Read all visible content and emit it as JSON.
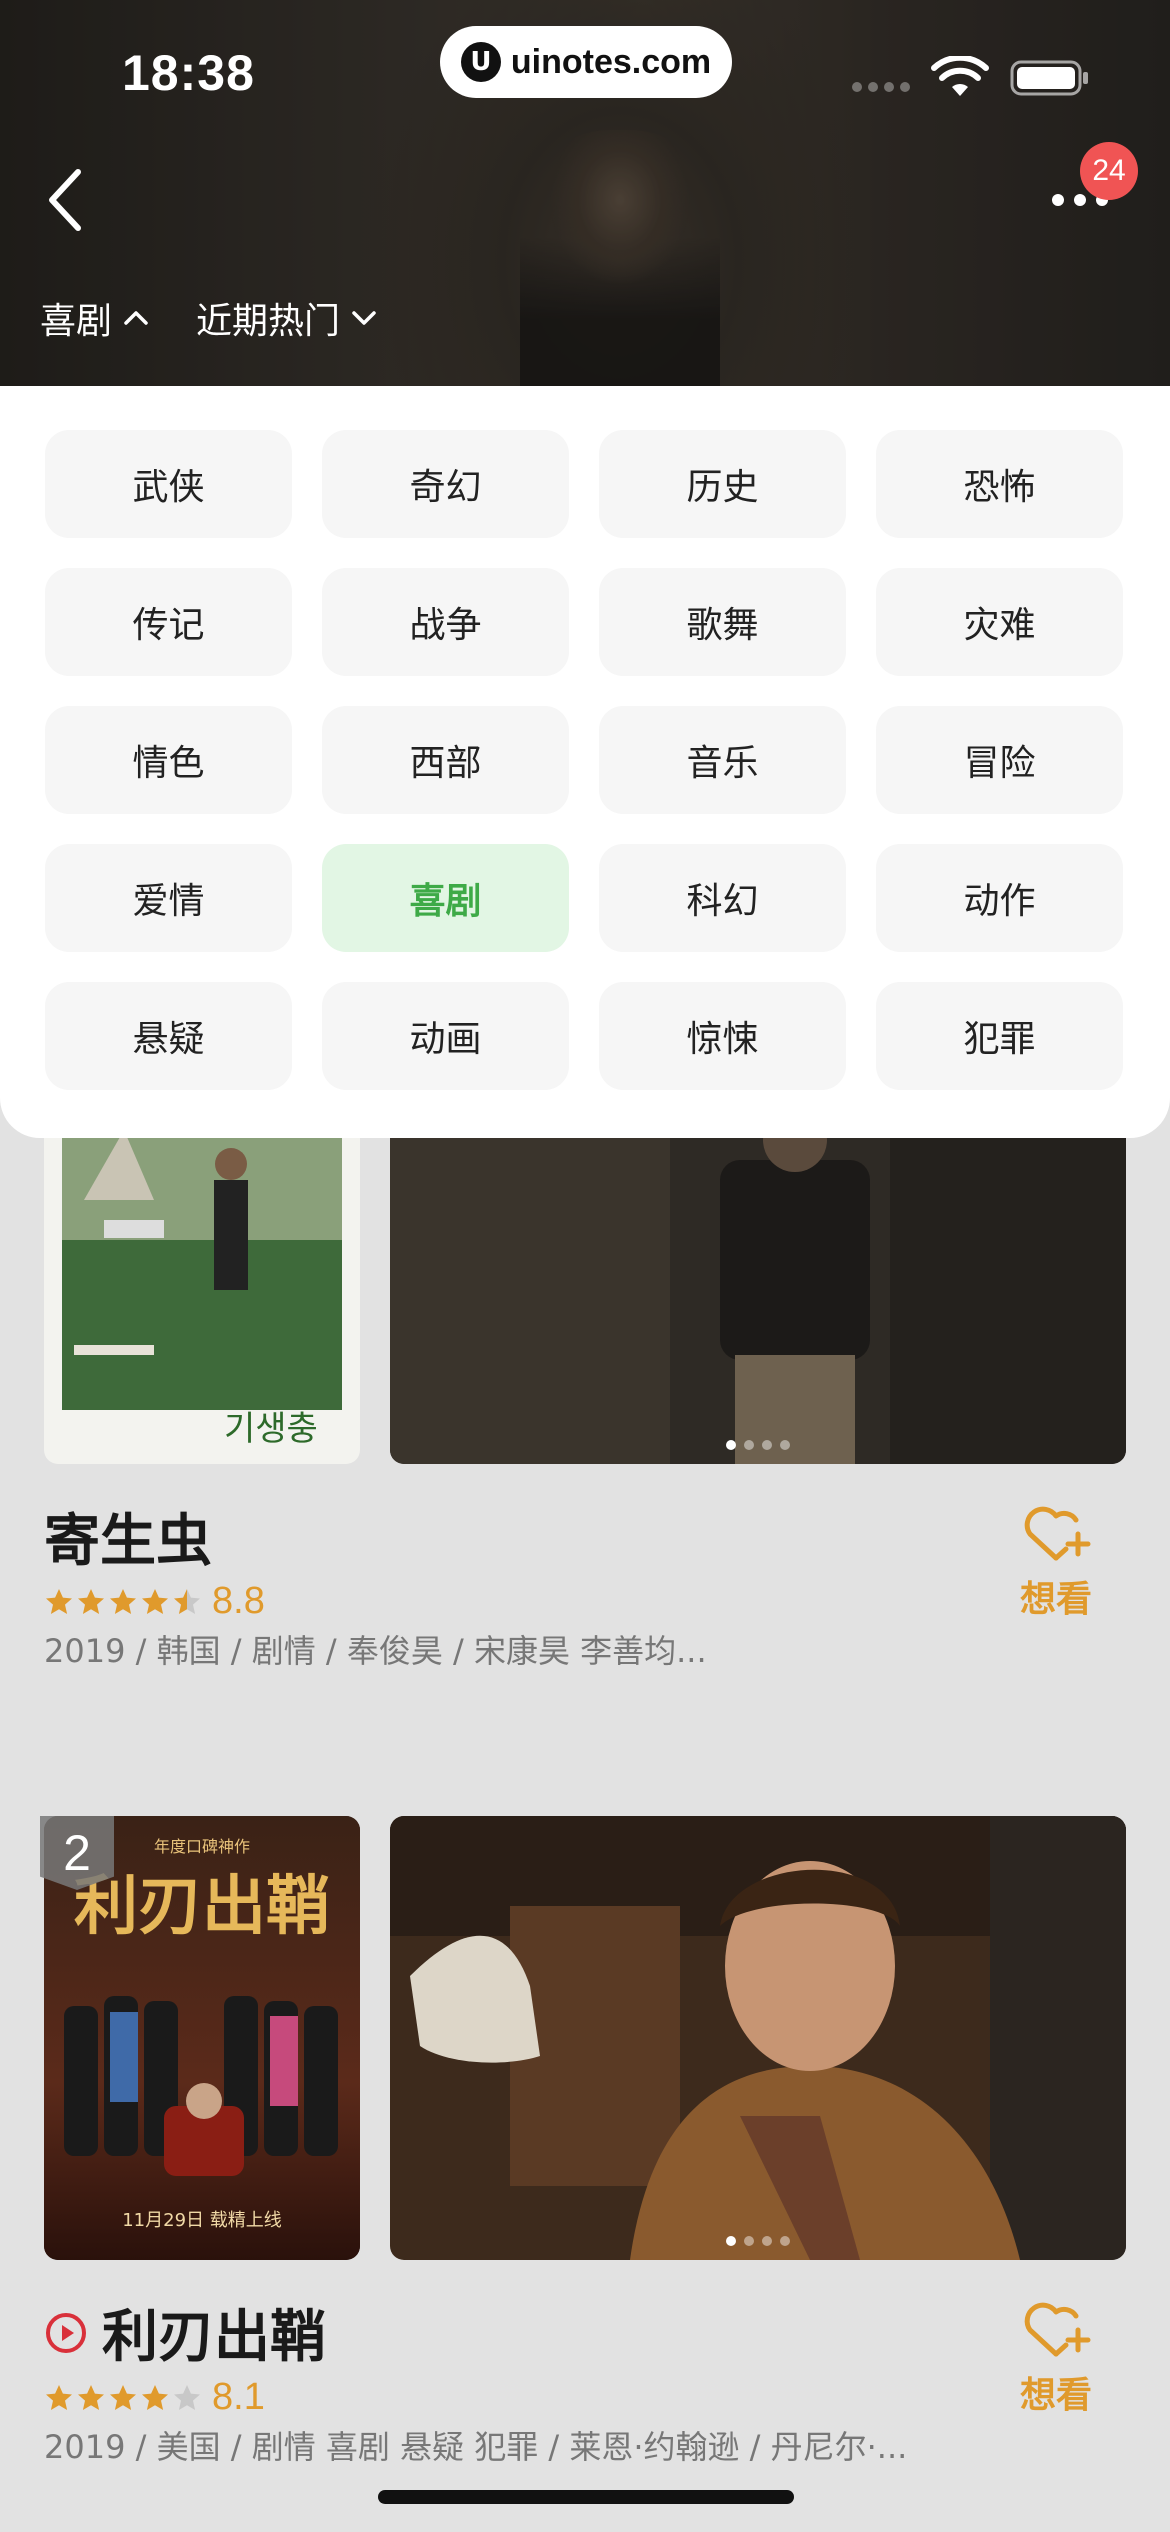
{
  "status_bar": {
    "time": "18:38",
    "url_logo": "U",
    "url": "uinotes.com"
  },
  "header": {
    "badge_count": "24"
  },
  "filters": [
    {
      "label": "喜剧",
      "icon": "chevron-up-icon"
    },
    {
      "label": "近期热门",
      "icon": "chevron-down-icon"
    }
  ],
  "genres": [
    {
      "label": "武侠",
      "active": false
    },
    {
      "label": "奇幻",
      "active": false
    },
    {
      "label": "历史",
      "active": false
    },
    {
      "label": "恐怖",
      "active": false
    },
    {
      "label": "传记",
      "active": false
    },
    {
      "label": "战争",
      "active": false
    },
    {
      "label": "歌舞",
      "active": false
    },
    {
      "label": "灾难",
      "active": false
    },
    {
      "label": "情色",
      "active": false
    },
    {
      "label": "西部",
      "active": false
    },
    {
      "label": "音乐",
      "active": false
    },
    {
      "label": "冒险",
      "active": false
    },
    {
      "label": "爱情",
      "active": false
    },
    {
      "label": "喜剧",
      "active": true
    },
    {
      "label": "科幻",
      "active": false
    },
    {
      "label": "动作",
      "active": false
    },
    {
      "label": "悬疑",
      "active": false
    },
    {
      "label": "动画",
      "active": false
    },
    {
      "label": "惊悚",
      "active": false
    },
    {
      "label": "犯罪",
      "active": false
    }
  ],
  "movies": [
    {
      "title": "寄生虫",
      "rating": "8.8",
      "stars": 4.5,
      "meta": "2019 / 韩国 / 剧情 / 奉俊昊 / 宋康昊 李善均...",
      "want_label": "想看",
      "poster_caption": "기생충"
    },
    {
      "rank": "2",
      "title": "利刃出鞘",
      "rating": "8.1",
      "stars": 4,
      "meta": "2019 / 美国 / 剧情 喜剧 悬疑 犯罪 / 莱恩·约翰逊 / 丹尼尔·...",
      "want_label": "想看",
      "poster_title": "利刃出鞘",
      "poster_tagline": "年度口碑神作",
      "poster_date": "11月29日 载精上线"
    }
  ],
  "colors": {
    "accent_green": "#3eaa47",
    "accent_orange": "#e09a2c",
    "badge_red": "#f05454"
  }
}
